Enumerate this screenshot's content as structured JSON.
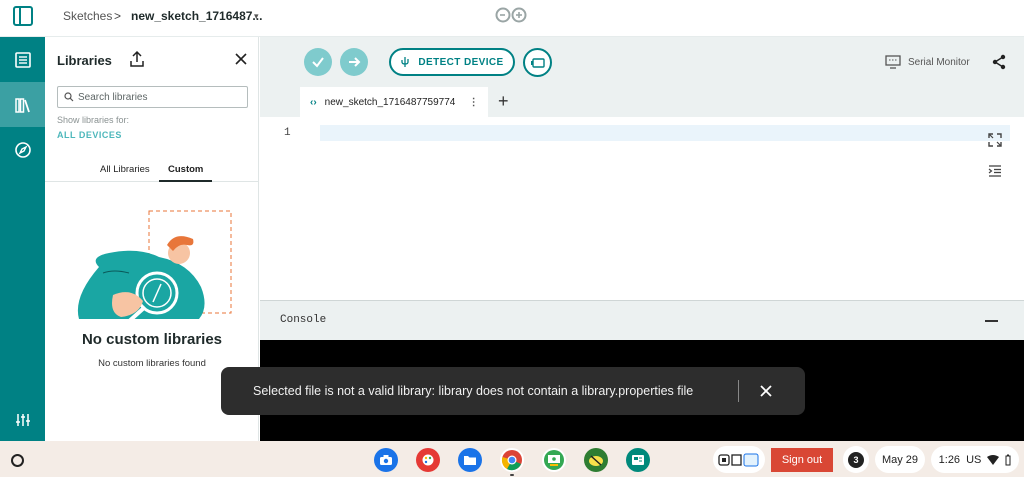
{
  "topbar": {
    "breadcrumb_root": "Sketches",
    "breadcrumb_sep": ">",
    "sketch_name": "new_sketch_1716487...",
    "caret": "▾"
  },
  "libraries": {
    "title": "Libraries",
    "search_placeholder": "Search libraries",
    "show_for_label": "Show libraries for:",
    "device_filter": "ALL DEVICES",
    "tabs": [
      "All Libraries",
      "Custom"
    ],
    "active_tab": "Custom",
    "empty_title": "No custom libraries",
    "empty_subtitle": "No custom libraries found"
  },
  "editor": {
    "detect_label": "DETECT DEVICE",
    "serial_monitor_label": "Serial Monitor",
    "file_tab_name": "new_sketch_1716487759774",
    "line_number": "1"
  },
  "console": {
    "title": "Console"
  },
  "toast": {
    "message": "Selected file is not a valid library: library does not contain a library.properties file"
  },
  "shelf": {
    "apps": [
      "camera-app-icon",
      "canvas-app-icon",
      "files-app-icon",
      "chrome-app-icon",
      "classroom-app-icon",
      "game-app-icon",
      "arduino-app-icon"
    ],
    "signout_label": "Sign out",
    "notification_count": "3",
    "date": "May 29",
    "time": "1:26",
    "ime": "US"
  },
  "colors": {
    "teal": "#008184",
    "teal_light": "#7fcbcd",
    "signout_red": "#d94735"
  }
}
